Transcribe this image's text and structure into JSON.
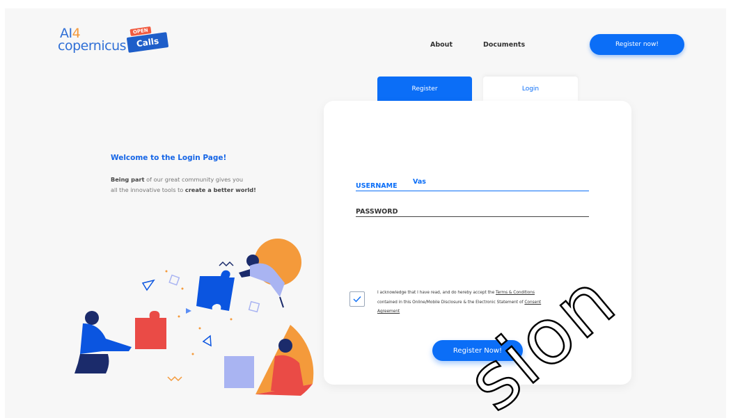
{
  "brand": {
    "ai": "AI",
    "four": "4",
    "copernicus": "copernicus",
    "badge_open": "OPEN",
    "badge_calls": "Calls"
  },
  "nav": {
    "about": "About",
    "documents": "Documents",
    "register_now": "Register now!"
  },
  "tabs": {
    "register": "Register",
    "login": "Login"
  },
  "welcome": {
    "title": "Welcome to the Login Page!",
    "bold1": "Being part",
    "text1": " of our great community gives you",
    "text2": "all the innovative tools to ",
    "bold2": "create a better world!"
  },
  "form": {
    "username_label": "USERNAME",
    "username_value": "Vas",
    "password_label": "PASSWORD",
    "checkbox_checked": true,
    "terms": {
      "part1": "I acknowledge that I have read, and do hereby accept the ",
      "link1": "Terms & Conditions",
      "part2": "contained in this Online/Mobile Disclosure & the Electronic Statement of ",
      "link2a": "Consent",
      "link2b": "Agreement"
    },
    "submit": "Register Now!"
  },
  "watermark": "sion",
  "colors": {
    "primary": "#0b6ef7",
    "orange": "#f49a3b",
    "red": "#ea4b46",
    "navy": "#1b2b6b",
    "lavender": "#a9b4f2"
  }
}
